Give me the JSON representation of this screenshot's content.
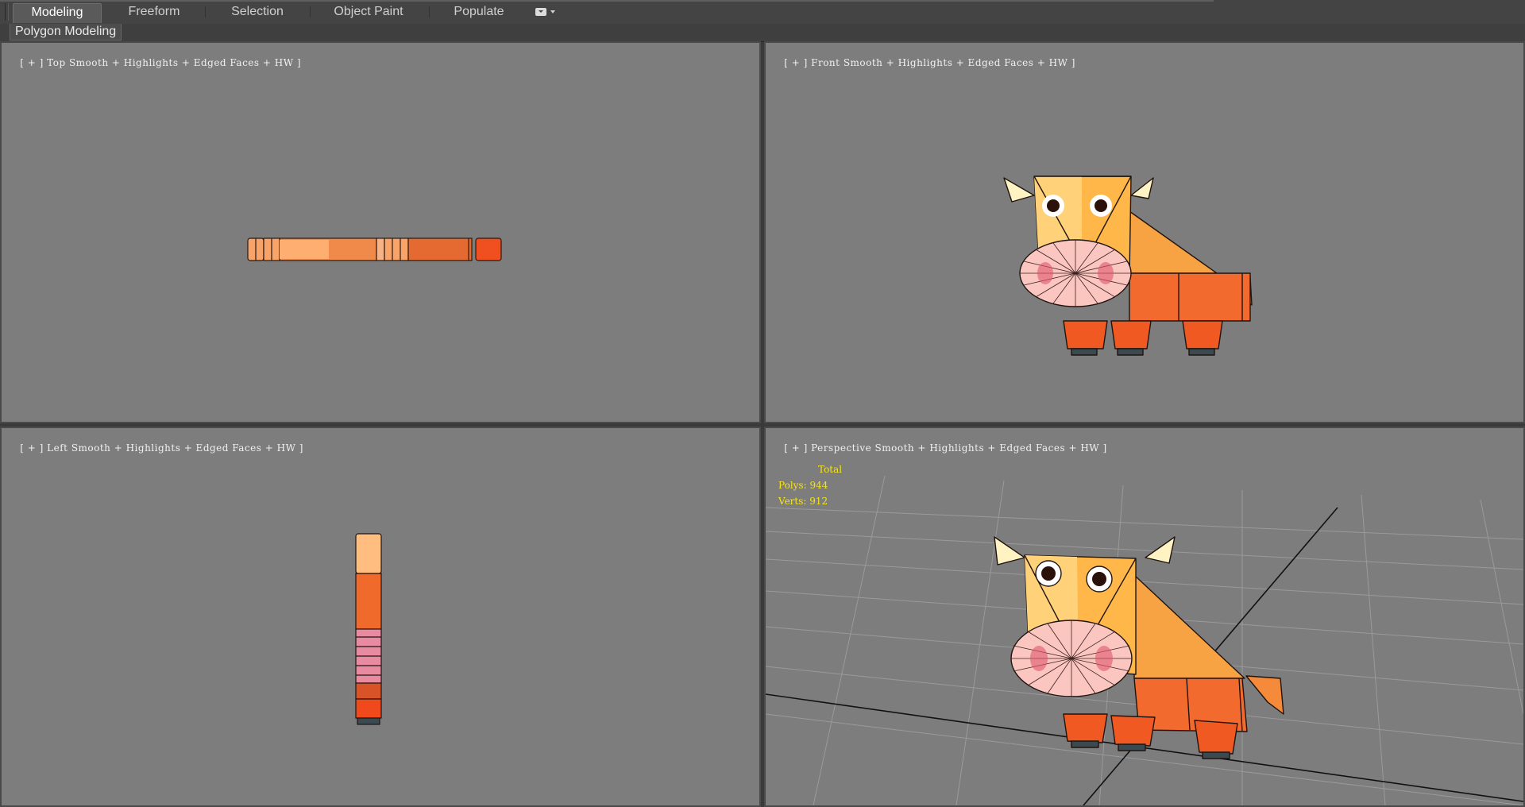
{
  "ribbon": {
    "tabs": [
      {
        "label": "Modeling",
        "active": true
      },
      {
        "label": "Freeform",
        "active": false
      },
      {
        "label": "Selection",
        "active": false
      },
      {
        "label": "Object Paint",
        "active": false
      },
      {
        "label": "Populate",
        "active": false
      }
    ],
    "options_icon": "toggle-options-icon",
    "panel_label": "Polygon Modeling"
  },
  "viewports": {
    "top": {
      "plus": "[ + ]",
      "view": "Top",
      "shading": "Smooth + Highlights + Edged Faces + HW ]"
    },
    "front": {
      "plus": "[ + ]",
      "view": "Front",
      "shading": "Smooth + Highlights + Edged Faces + HW ]"
    },
    "left": {
      "plus": "[ + ]",
      "view": "Left",
      "shading": "Smooth + Highlights + Edged Faces + HW ]"
    },
    "perspective": {
      "plus": "[ + ]",
      "view": "Perspective",
      "shading": "Smooth + Highlights + Edged Faces + HW ]",
      "stats": {
        "title": "Total",
        "polys": "Polys: 944",
        "verts": "Verts: 912"
      }
    }
  },
  "colors": {
    "viewport_bg": "#7d7d7d",
    "model_orange": "#f07a3a",
    "model_light": "#ffc27a",
    "horn": "#fff1c0",
    "nose": "#f7b8b8",
    "stats_text": "#f5e419"
  }
}
